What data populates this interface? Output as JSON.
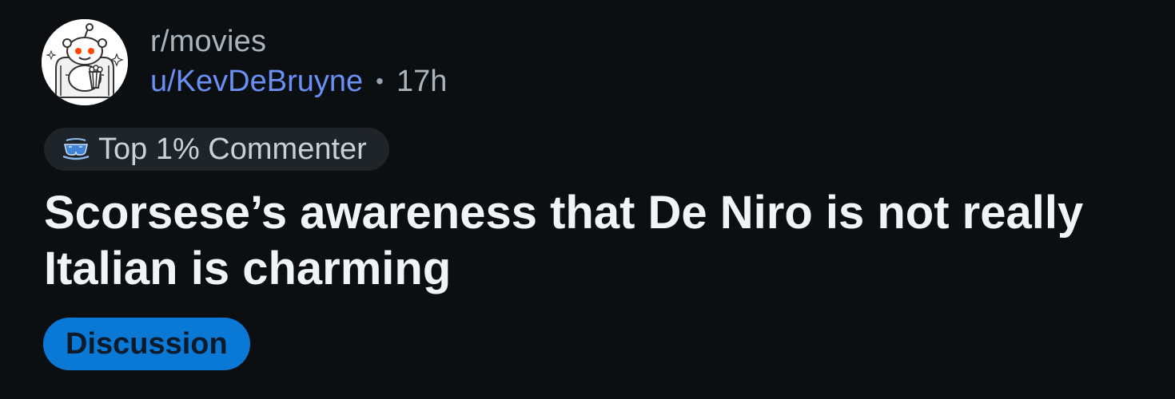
{
  "post": {
    "subreddit": "r/movies",
    "username": "u/KevDeBruyne",
    "separator": "•",
    "age": "17h",
    "flair": {
      "icon": "sunglasses-icon",
      "label": "Top 1% Commenter"
    },
    "title": "Scorsese’s awareness that De Niro is not really Italian is charming",
    "tag": {
      "label": "Discussion",
      "color": "#0a79d6"
    }
  },
  "colors": {
    "background": "#0c0f12",
    "username": "#6a8ff5",
    "muted": "#aab4bd",
    "flair_bg": "#1f2428"
  }
}
